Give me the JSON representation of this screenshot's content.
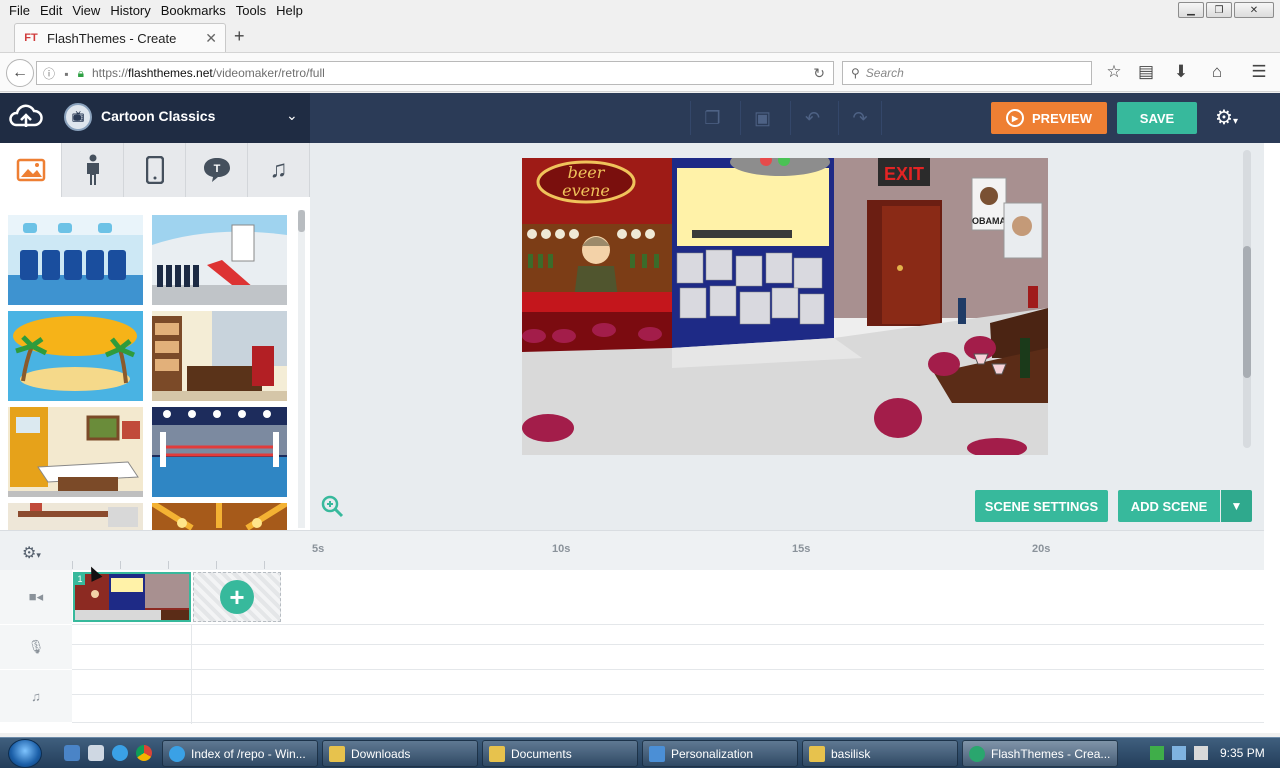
{
  "browser": {
    "menu": [
      "File",
      "Edit",
      "View",
      "History",
      "Bookmarks",
      "Tools",
      "Help"
    ],
    "tab_title": "FlashThemes - Create",
    "tab_favicon": "FT",
    "url_prefix": "https://",
    "url_host": "flashthemes.net",
    "url_path": "/videomaker/retro/full",
    "search_placeholder": "Search"
  },
  "app": {
    "theme_name": "Cartoon Classics",
    "preview_label": "PREVIEW",
    "save_label": "SAVE",
    "scene_settings_label": "SCENE SETTINGS",
    "add_scene_label": "ADD SCENE",
    "asset_tabs": [
      "backgrounds",
      "characters",
      "props",
      "text",
      "music"
    ],
    "thumbnails": [
      "airplane cabin",
      "airplane exterior",
      "beach island",
      "office desk",
      "office room",
      "boxing ring",
      "shelf room",
      "theater"
    ],
    "stage_signs": {
      "beer_sign_1": "beer",
      "beer_sign_2": "evene",
      "exit_sign": "EXIT",
      "poster_name": "OBAMA"
    }
  },
  "timeline": {
    "ticks": [
      "5s",
      "10s",
      "15s",
      "20s"
    ],
    "scene_number": "1",
    "tracks": [
      "video",
      "voice",
      "music"
    ]
  },
  "taskbar": {
    "items": [
      {
        "label": "Index of /repo - Win...",
        "icon": "ie-icon"
      },
      {
        "label": "Downloads",
        "icon": "folder-icon"
      },
      {
        "label": "Documents",
        "icon": "folder-icon"
      },
      {
        "label": "Personalization",
        "icon": "display-icon"
      },
      {
        "label": "basilisk",
        "icon": "folder-icon"
      },
      {
        "label": "FlashThemes - Crea...",
        "icon": "browser-icon"
      }
    ],
    "clock": "9:35 PM"
  },
  "colors": {
    "header_dark": "#1f2c43",
    "header": "#2b3b57",
    "accent_orange": "#ee7f33",
    "accent_teal": "#37b99c"
  }
}
